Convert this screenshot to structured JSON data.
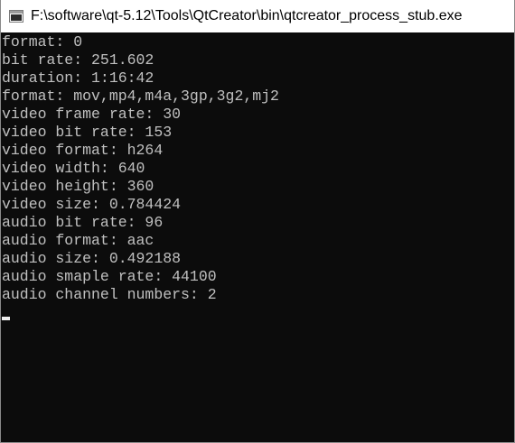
{
  "window": {
    "title": "F:\\software\\qt-5.12\\Tools\\QtCreator\\bin\\qtcreator_process_stub.exe",
    "icon": "console-window-icon"
  },
  "console": {
    "background": "#0c0c0c",
    "foreground": "#c0c0c0",
    "lines": [
      "format: 0",
      "bit rate: 251.602",
      "duration: 1:16:42",
      "format: mov,mp4,m4a,3gp,3g2,mj2",
      "video frame rate: 30",
      "video bit rate: 153",
      "video format: h264",
      "video width: 640",
      "video height: 360",
      "video size: 0.784424",
      "audio bit rate: 96",
      "audio format: aac",
      "audio size: 0.492188",
      "audio smaple rate: 44100",
      "audio channel numbers: 2"
    ]
  }
}
